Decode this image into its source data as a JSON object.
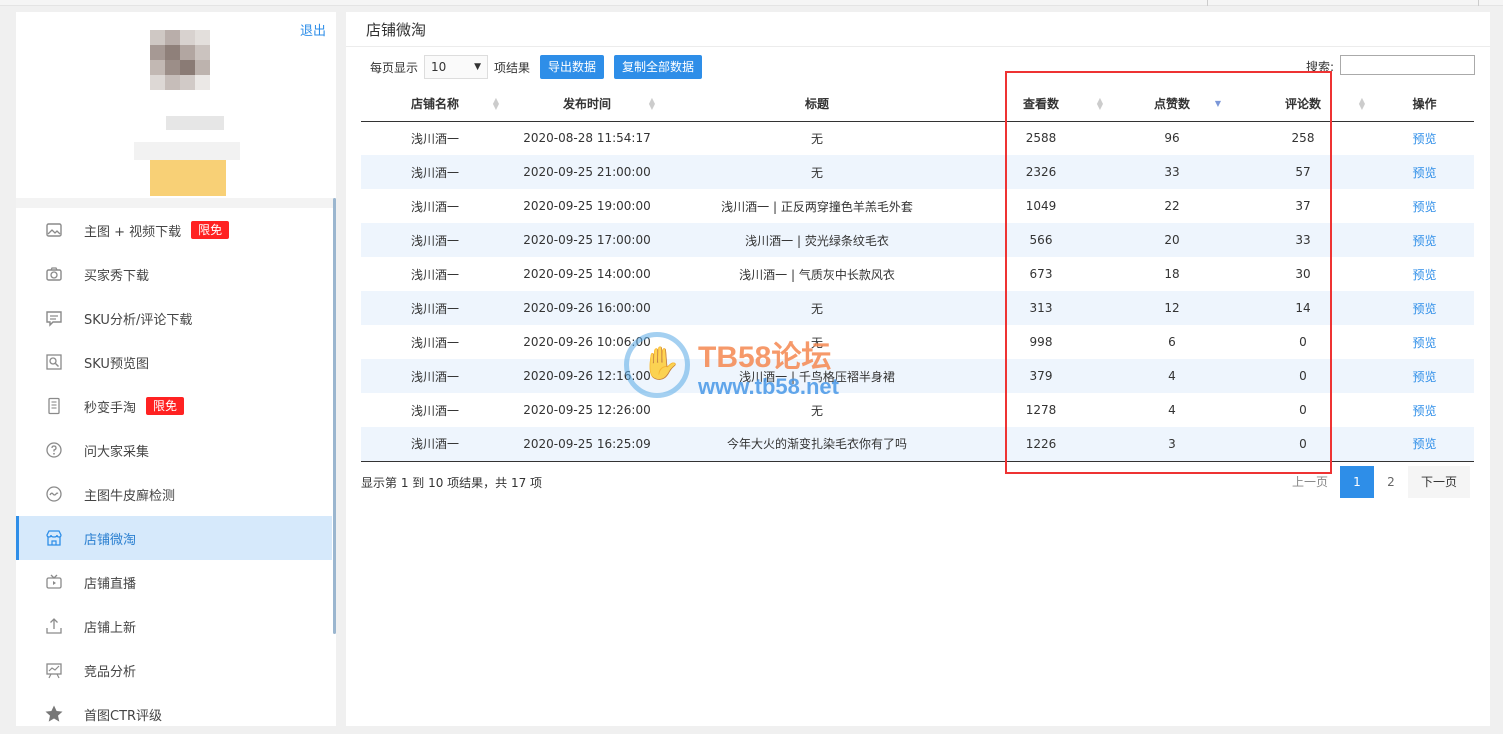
{
  "sidebar": {
    "logout": "退出",
    "items": [
      {
        "label": "主图 + 视频下载",
        "icon": "image-icon",
        "badge": "限免"
      },
      {
        "label": "买家秀下载",
        "icon": "camera-icon",
        "badge": ""
      },
      {
        "label": "SKU分析/评论下载",
        "icon": "comment-icon",
        "badge": ""
      },
      {
        "label": "SKU预览图",
        "icon": "search-image-icon",
        "badge": ""
      },
      {
        "label": "秒变手淘",
        "icon": "phone-icon",
        "badge": "限免"
      },
      {
        "label": "问大家采集",
        "icon": "question-icon",
        "badge": ""
      },
      {
        "label": "主图牛皮廯检测",
        "icon": "wave-icon",
        "badge": ""
      },
      {
        "label": "店铺微淘",
        "icon": "store-icon",
        "badge": "",
        "active": true
      },
      {
        "label": "店铺直播",
        "icon": "tv-icon",
        "badge": ""
      },
      {
        "label": "店铺上新",
        "icon": "upload-icon",
        "badge": ""
      },
      {
        "label": "竞品分析",
        "icon": "analysis-icon",
        "badge": ""
      },
      {
        "label": "首图CTR评级",
        "icon": "star-icon",
        "badge": ""
      }
    ]
  },
  "main": {
    "title": "店铺微淘",
    "per_page_label": "每页显示",
    "per_page_value": "10",
    "per_page_suffix": "项结果",
    "export_btn": "导出数据",
    "copy_btn": "复制全部数据",
    "search_label": "搜索:",
    "search_value": ""
  },
  "table": {
    "headers": [
      "店铺名称",
      "发布时间",
      "标题",
      "查看数",
      "点赞数",
      "评论数",
      "操作"
    ],
    "rows": [
      [
        "浅川酒一",
        "2020-08-28 11:54:17",
        "无",
        "2588",
        "96",
        "258",
        "预览"
      ],
      [
        "浅川酒一",
        "2020-09-25 21:00:00",
        "无",
        "2326",
        "33",
        "57",
        "预览"
      ],
      [
        "浅川酒一",
        "2020-09-25 19:00:00",
        "浅川酒一 | 正反两穿撞色羊羔毛外套",
        "1049",
        "22",
        "37",
        "预览"
      ],
      [
        "浅川酒一",
        "2020-09-25 17:00:00",
        "浅川酒一 | 荧光绿条纹毛衣",
        "566",
        "20",
        "33",
        "预览"
      ],
      [
        "浅川酒一",
        "2020-09-25 14:00:00",
        "浅川酒一 | 气质灰中长款风衣",
        "673",
        "18",
        "30",
        "预览"
      ],
      [
        "浅川酒一",
        "2020-09-26 16:00:00",
        "无",
        "313",
        "12",
        "14",
        "预览"
      ],
      [
        "浅川酒一",
        "2020-09-26 10:06:00",
        "无",
        "998",
        "6",
        "0",
        "预览"
      ],
      [
        "浅川酒一",
        "2020-09-26 12:16:00",
        "浅川酒一 | 千鸟格压褶半身裙",
        "379",
        "4",
        "0",
        "预览"
      ],
      [
        "浅川酒一",
        "2020-09-25 12:26:00",
        "无",
        "1278",
        "4",
        "0",
        "预览"
      ],
      [
        "浅川酒一",
        "2020-09-25 16:25:09",
        "今年大火的渐变扎染毛衣你有了吗",
        "1226",
        "3",
        "0",
        "预览"
      ]
    ]
  },
  "footer": {
    "info": "显示第 1 到 10 项结果，共 17 项",
    "prev": "上一页",
    "pages": [
      "1",
      "2"
    ],
    "current_page": "1",
    "next": "下一页"
  },
  "watermark": {
    "line1": "TB58论坛",
    "line2": "www.tb58.net"
  },
  "colors": {
    "accent": "#2e8ee8",
    "badge": "#ff2222",
    "highlight_box": "#e33333",
    "stripe": "#eef5fd"
  }
}
